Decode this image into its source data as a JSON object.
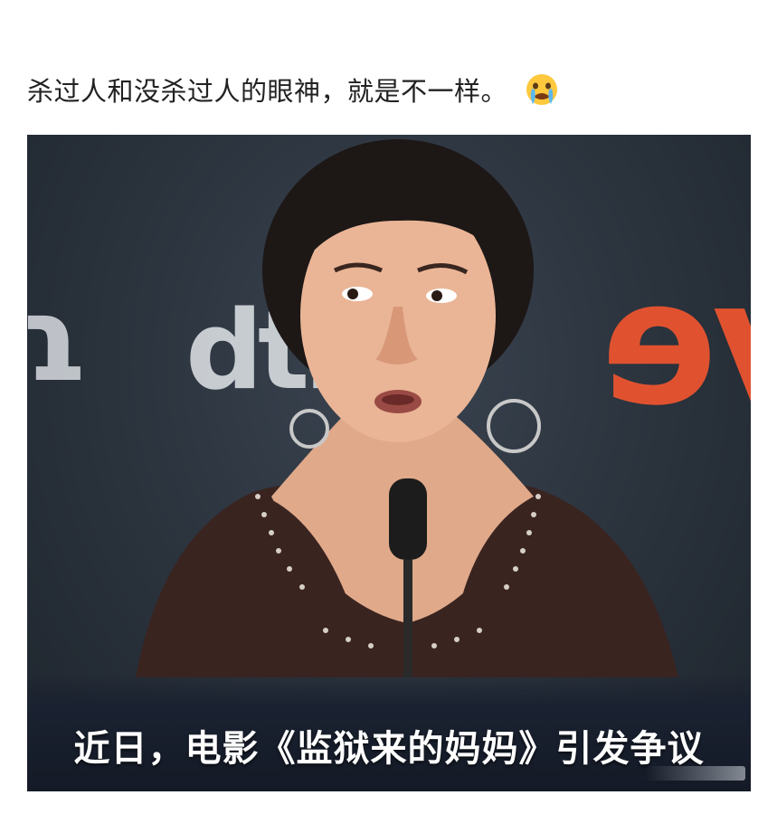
{
  "post": {
    "text": "杀过人和没杀过人的眼神，就是不一样。",
    "emoji_icon": "crying-face-icon"
  },
  "video": {
    "subtitle": "近日，电影《监狱来的妈妈》引发争议",
    "backdrop_logos": {
      "left": "ɿ",
      "middle": "dtb",
      "right": "ve"
    }
  },
  "colors": {
    "background": "#ffffff",
    "text": "#222222",
    "video_backdrop": "#2a323c",
    "logo_orange": "#e0522f",
    "subtitle_text": "#ffffff"
  }
}
